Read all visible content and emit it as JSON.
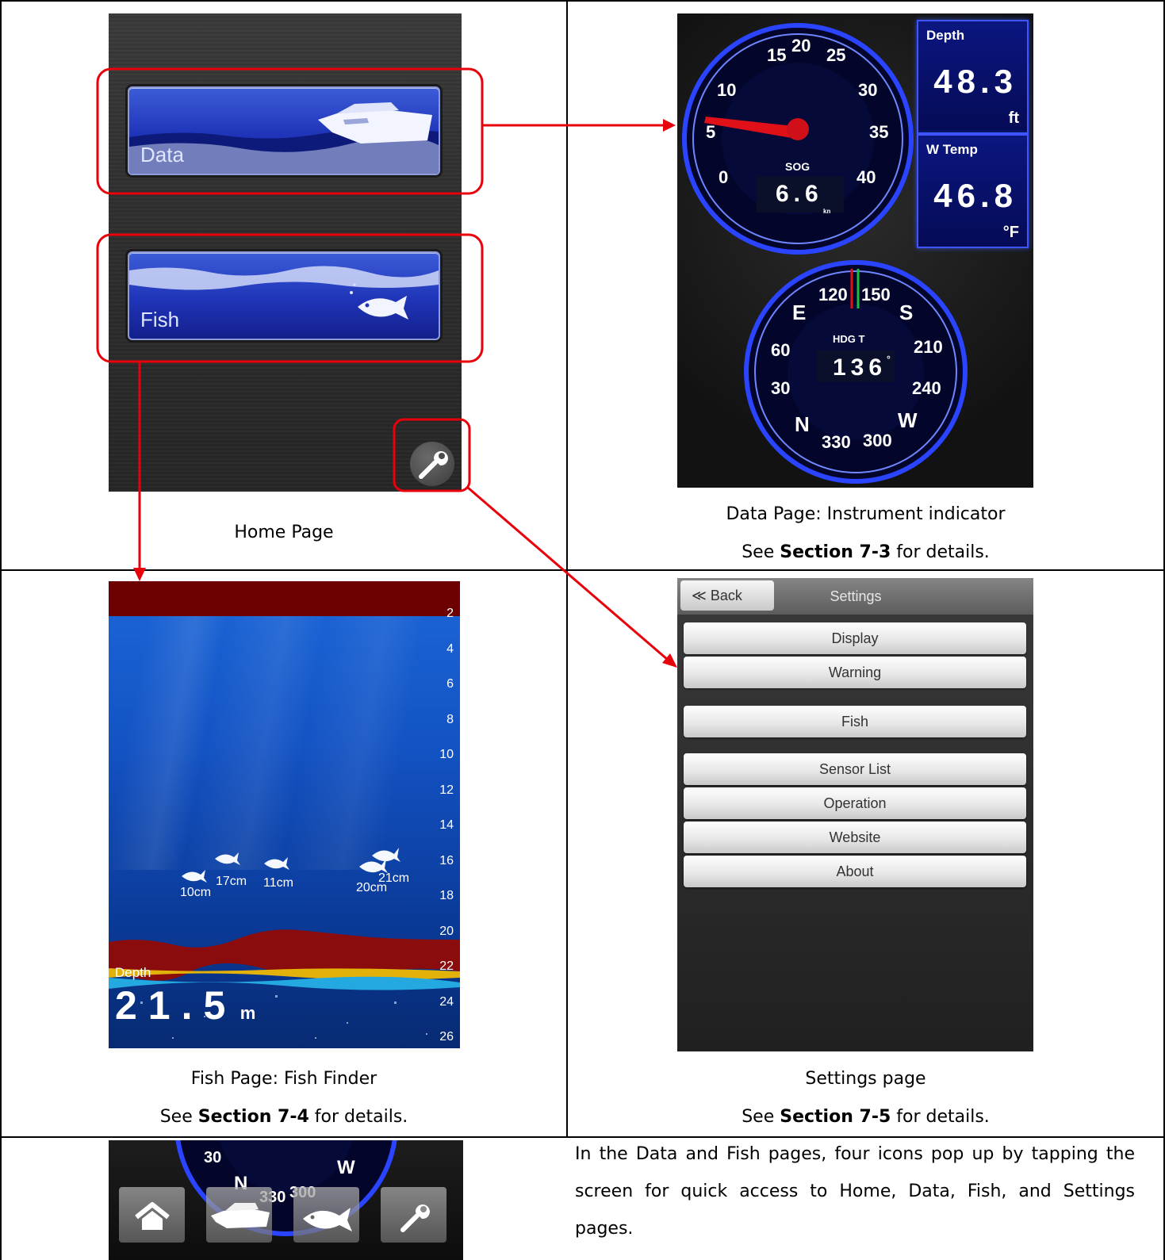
{
  "home": {
    "data_button_label": "Data",
    "fish_button_label": "Fish",
    "caption": "Home Page"
  },
  "data_page": {
    "speed_gauge": {
      "ticks": [
        "15",
        "20",
        "25",
        "10",
        "30",
        "5",
        "35",
        "0",
        "40"
      ],
      "label": "SOG",
      "value": "6.6",
      "unit": "kn"
    },
    "depth_box": {
      "title": "Depth",
      "value": "48.3",
      "unit": "ft"
    },
    "temp_box": {
      "title": "W Temp",
      "value": "46.8",
      "unit": "°F"
    },
    "compass": {
      "labels": [
        "120",
        "150",
        "E",
        "S",
        "60",
        "210",
        "30",
        "240",
        "N",
        "W",
        "330",
        "300"
      ],
      "heading_label": "HDG T",
      "heading_value": "136",
      "degree_mark": "°"
    },
    "caption_line1": "Data Page: Instrument indicator",
    "caption_see": "See ",
    "caption_section": "Section 7-3",
    "caption_end": " for details."
  },
  "fish_page": {
    "scale": [
      "2",
      "4",
      "6",
      "8",
      "10",
      "12",
      "14",
      "16",
      "18",
      "20",
      "22",
      "24",
      "26"
    ],
    "fish_sizes": [
      "10cm",
      "17cm",
      "11cm",
      "20cm",
      "21cm"
    ],
    "depth_label": "Depth",
    "depth_value": "21.5",
    "depth_unit": "m",
    "caption_line1": "Fish Page: Fish Finder",
    "caption_see": "See ",
    "caption_section": "Section 7-4",
    "caption_end": " for details."
  },
  "settings_page": {
    "back_label": "Back",
    "title": "Settings",
    "items": [
      "Display",
      "Warning",
      "Fish",
      "Sensor List",
      "Operation",
      "Website",
      "About"
    ],
    "caption_line1": "Settings page",
    "caption_see": "See ",
    "caption_section": "Section 7-5",
    "caption_end": " for details."
  },
  "toolbar": {
    "labels": [
      "30",
      "W",
      "N",
      "330",
      "300"
    ],
    "icons": [
      "home-icon",
      "boat-icon",
      "fish-icon",
      "wrench-icon"
    ]
  },
  "description": "In the Data and Fish pages, four icons pop up by tapping the screen for quick access to Home, Data, Fish, and Settings pages.",
  "colors": {
    "highlight": "#e8000b",
    "button_blue": "#1f34b8",
    "gauge_ring": "#2a44ff"
  }
}
